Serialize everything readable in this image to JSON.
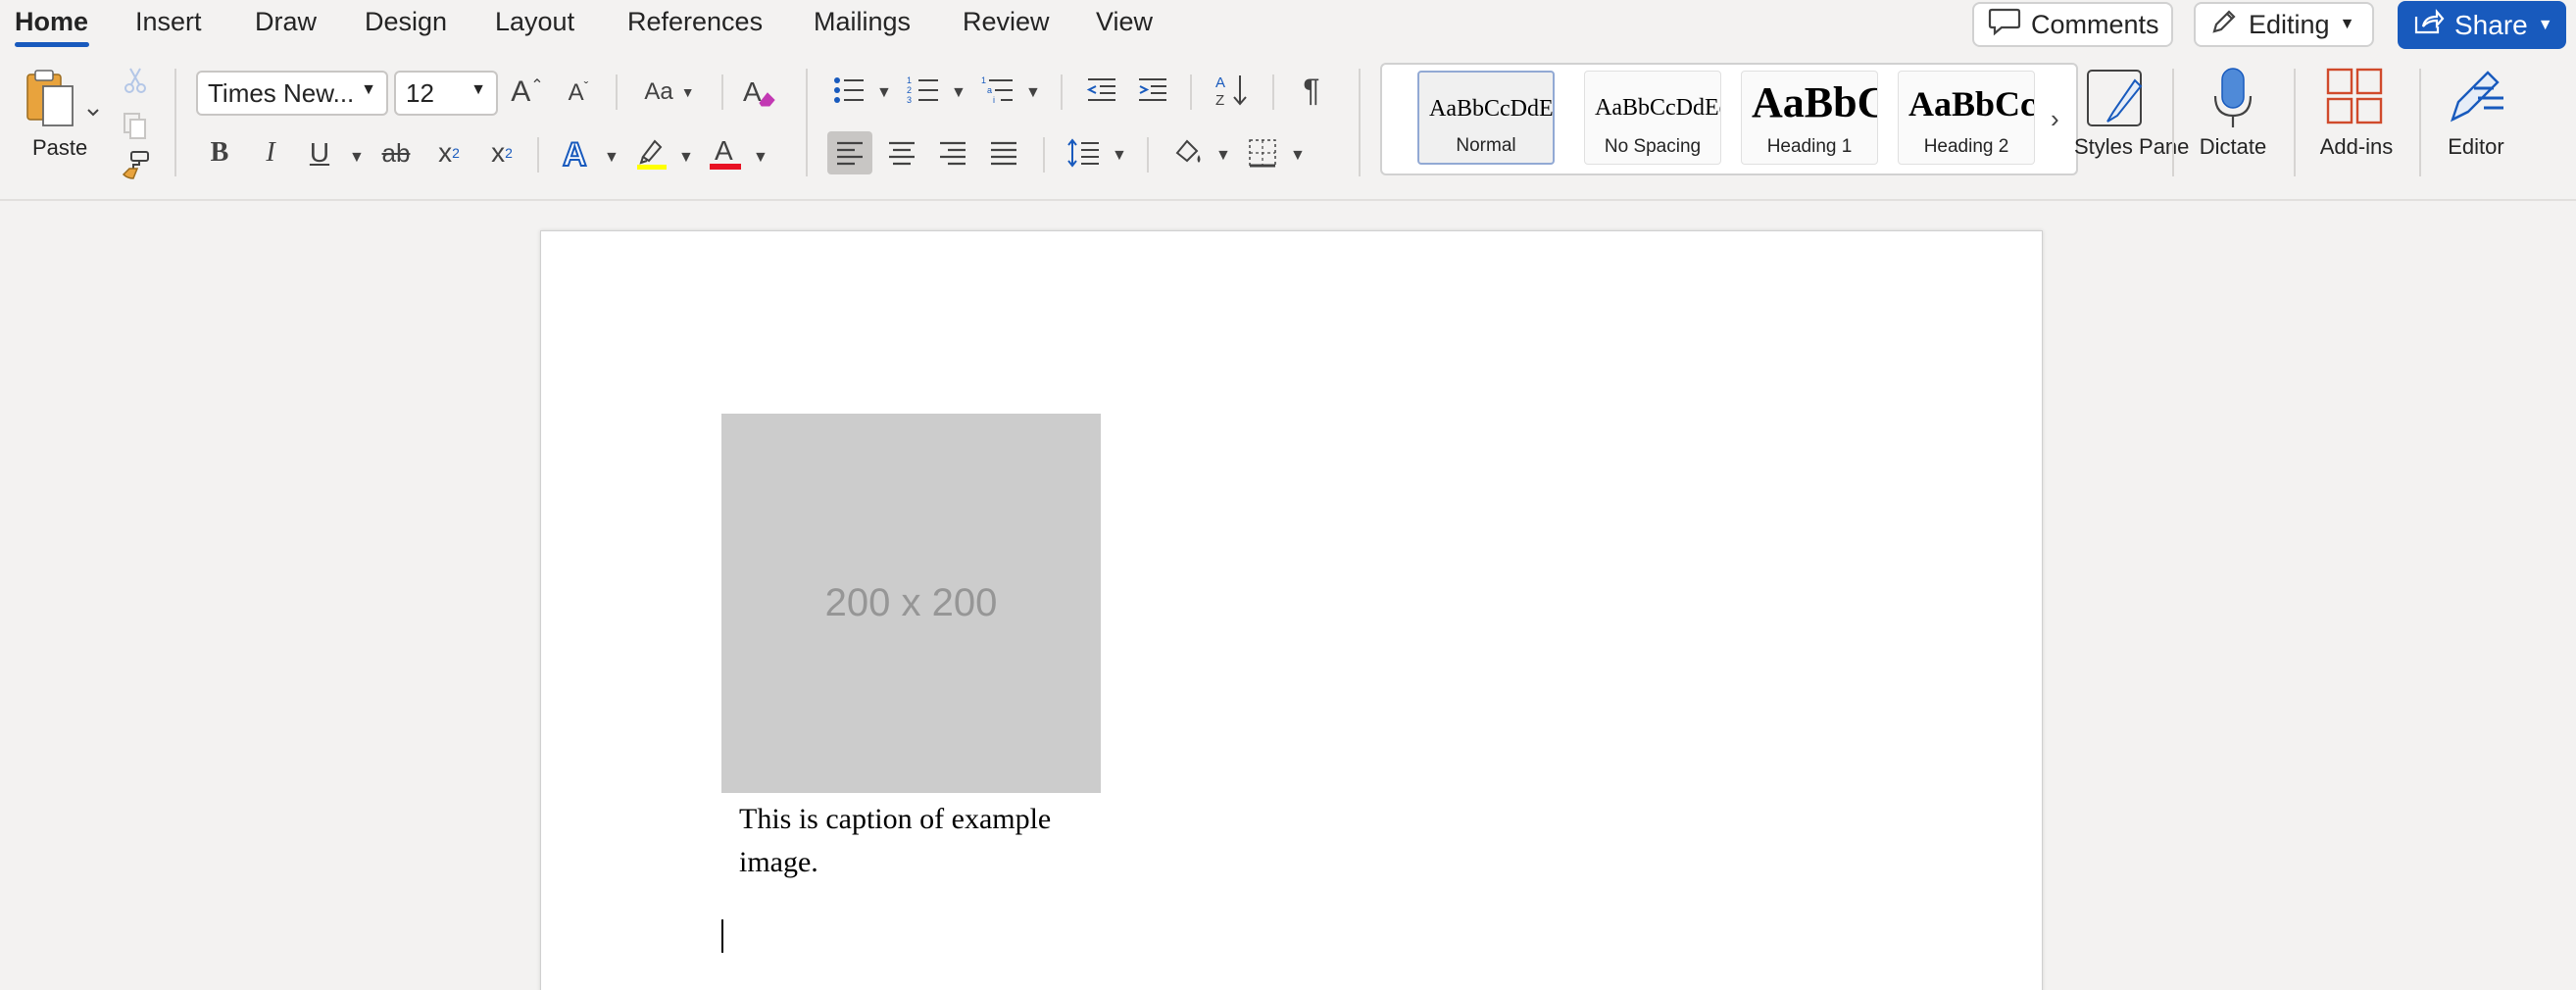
{
  "menu": {
    "tabs": [
      "Home",
      "Insert",
      "Draw",
      "Design",
      "Layout",
      "References",
      "Mailings",
      "Review",
      "View"
    ],
    "comments_label": "Comments",
    "editing_label": "Editing",
    "share_label": "Share"
  },
  "ribbon": {
    "clipboard": {
      "paste_label": "Paste"
    },
    "font": {
      "font_name": "Times New...",
      "font_size": "12",
      "change_case": "Aa"
    },
    "format_buttons": {
      "bold": "B",
      "italic": "I",
      "underline": "U",
      "strikethrough": "ab",
      "subscript": "x",
      "superscript": "x"
    },
    "styles": [
      {
        "sample": "AaBbCcDdEe",
        "name": "Normal",
        "selected": true
      },
      {
        "sample": "AaBbCcDdEe",
        "name": "No Spacing",
        "selected": false
      },
      {
        "sample": "AaBbC",
        "name": "Heading 1",
        "selected": false
      },
      {
        "sample": "AaBbCc",
        "name": "Heading 2",
        "selected": false
      }
    ],
    "styles_pane_label": "Styles Pane",
    "dictate_label": "Dictate",
    "addins_label": "Add-ins",
    "editor_label": "Editor"
  },
  "document": {
    "image_placeholder_text": "200 x 200",
    "caption": "This is caption of example image."
  },
  "colors": {
    "accent": "#185abd",
    "highlight": "#ffff00",
    "font_color": "#e81123",
    "addins": "#d04a2b"
  }
}
